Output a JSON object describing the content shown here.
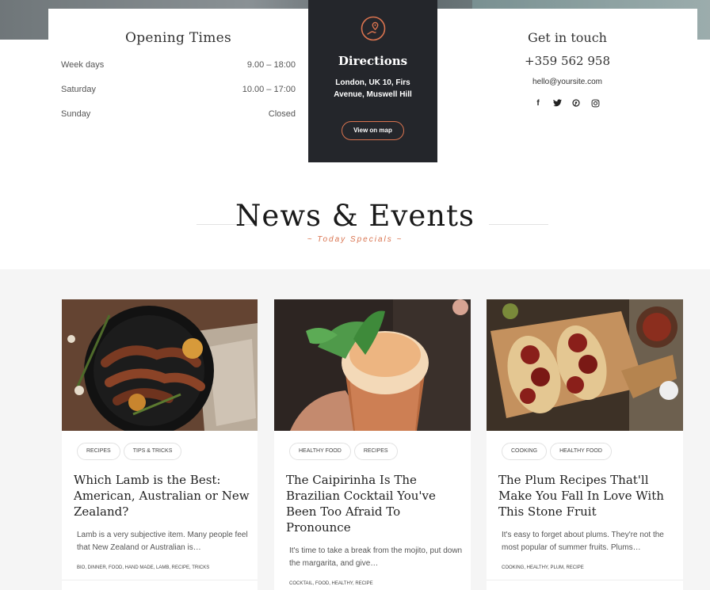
{
  "hours": {
    "title": "Opening Times",
    "rows": [
      {
        "day": "Week days",
        "time": "9.00 – 18:00"
      },
      {
        "day": "Saturday",
        "time": "10.00 – 17:00"
      },
      {
        "day": "Sunday",
        "time": "Closed"
      }
    ]
  },
  "directions": {
    "title": "Directions",
    "address": "London, UK 10, Firs Avenue, Muswell Hill",
    "button": "View on map",
    "accent": "#d9734f"
  },
  "contact": {
    "title": "Get in touch",
    "phone": "+359 562 958",
    "email": "hello@yoursite.com",
    "social": [
      "facebook-icon",
      "twitter-icon",
      "pinterest-icon",
      "instagram-icon"
    ]
  },
  "news": {
    "title": "News & Events",
    "subtitle": "~ Today Specials ~"
  },
  "posts": [
    {
      "tags": [
        "RECIPES",
        "TIPS & TRICKS"
      ],
      "title": "Which Lamb is the Best: American, Australian or New Zealand?",
      "excerpt": "Lamb is a very subjective item. Many people feel that New Zealand or Australian is…",
      "meta": "BIO, DINNER, FOOD, HAND MADE, LAMB, RECIPE, TRICKS"
    },
    {
      "tags": [
        "HEALTHY FOOD",
        "RECIPES"
      ],
      "title": "The Caipirinha Is The Brazilian Cocktail You've Been Too Afraid To Pronounce",
      "excerpt": "It's time to take a break from the mojito, put down the margarita, and give…",
      "meta": "COCKTAIL, FOOD, HEALTHY, RECIPE"
    },
    {
      "tags": [
        "COOKING",
        "HEALTHY FOOD"
      ],
      "title": "The Plum Recipes That'll Make You Fall In Love With This Stone Fruit",
      "excerpt": "It's easy to forget about plums. They're not the most popular of summer fruits. Plums…",
      "meta": "COOKING, HEALTHY, PLUM, RECIPE"
    }
  ]
}
